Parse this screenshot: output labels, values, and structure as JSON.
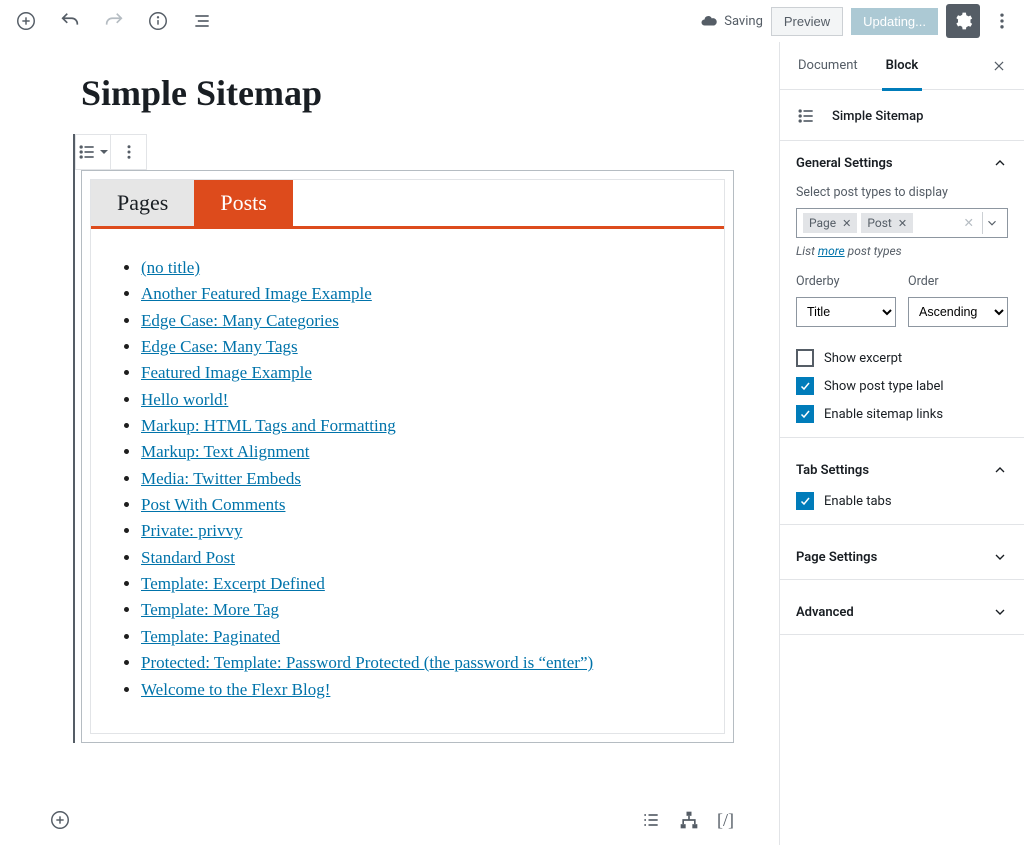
{
  "toolbar": {
    "saving_label": "Saving",
    "preview_label": "Preview",
    "updating_label": "Updating..."
  },
  "editor": {
    "title": "Simple Sitemap",
    "tabs": [
      {
        "label": "Pages",
        "active": false
      },
      {
        "label": "Posts",
        "active": true
      }
    ],
    "posts": [
      "(no title)",
      "Another Featured Image Example",
      "Edge Case: Many Categories",
      "Edge Case: Many Tags",
      "Featured Image Example",
      "Hello world!",
      "Markup: HTML Tags and Formatting",
      "Markup: Text Alignment",
      "Media: Twitter Embeds",
      "Post With Comments",
      "Private: privvy",
      "Standard Post",
      "Template: Excerpt Defined",
      "Template: More Tag",
      "Template: Paginated",
      "Protected: Template: Password Protected (the password is “enter”)",
      "Welcome to the Flexr Blog!"
    ],
    "bottom_shortcode": "[/]"
  },
  "sidebar": {
    "tabs": {
      "document": "Document",
      "block": "Block"
    },
    "block_name": "Simple Sitemap",
    "panels": {
      "general": {
        "title": "General Settings",
        "select_label": "Select post types to display",
        "tokens": [
          "Page",
          "Post"
        ],
        "list_prefix": "List ",
        "list_link": "more",
        "list_suffix": " post types",
        "orderby": {
          "label": "Orderby",
          "value": "Title"
        },
        "order": {
          "label": "Order",
          "value": "Ascending"
        },
        "show_excerpt": {
          "label": "Show excerpt",
          "checked": false
        },
        "show_post_type_label": {
          "label": "Show post type label",
          "checked": true
        },
        "enable_sitemap_links": {
          "label": "Enable sitemap links",
          "checked": true
        }
      },
      "tab": {
        "title": "Tab Settings",
        "enable_tabs": {
          "label": "Enable tabs",
          "checked": true
        }
      },
      "page": {
        "title": "Page Settings"
      },
      "advanced": {
        "title": "Advanced"
      }
    }
  }
}
